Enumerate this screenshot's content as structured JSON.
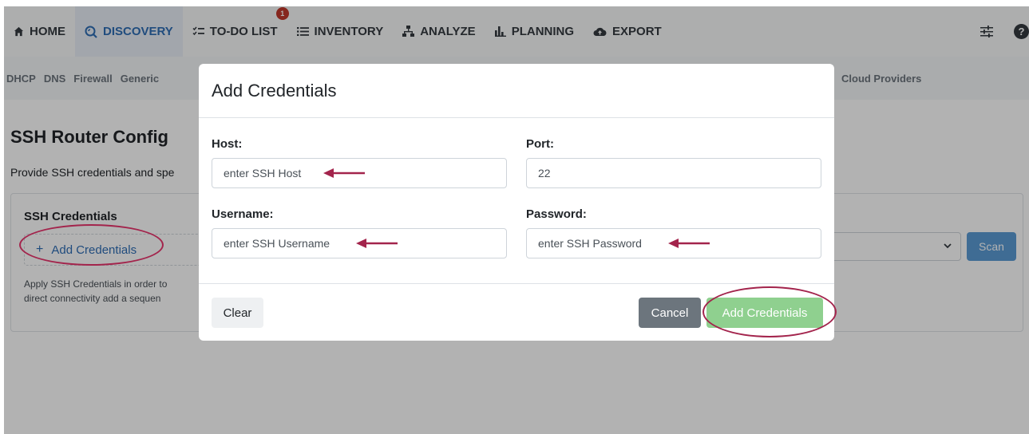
{
  "nav": {
    "items": [
      {
        "label": "HOME",
        "icon": "home-icon"
      },
      {
        "label": "DISCOVERY",
        "icon": "discovery-icon",
        "active": true
      },
      {
        "label": "TO-DO LIST",
        "icon": "checklist-icon",
        "badge": "1"
      },
      {
        "label": "INVENTORY",
        "icon": "list-icon"
      },
      {
        "label": "ANALYZE",
        "icon": "network-icon"
      },
      {
        "label": "PLANNING",
        "icon": "bar-chart-icon"
      },
      {
        "label": "EXPORT",
        "icon": "cloud-upload-icon"
      }
    ],
    "right_icons": [
      "sliders-icon",
      "help-icon"
    ]
  },
  "subnav": {
    "items": [
      "DHCP",
      "DNS",
      "Firewall",
      "Generic"
    ],
    "right_item": "Cloud Providers"
  },
  "page": {
    "title": "SSH Router Config",
    "subtitle": "Provide SSH credentials and spe"
  },
  "card": {
    "title": "SSH Credentials",
    "add_label": "Add Credentials",
    "help_line1": "Apply SSH Credentials in order to",
    "help_line2": "direct connectivity add a sequen",
    "scan_label": "Scan"
  },
  "modal": {
    "title": "Add Credentials",
    "host": {
      "label": "Host:",
      "placeholder": "enter SSH Host"
    },
    "port": {
      "label": "Port:",
      "value": "22"
    },
    "username": {
      "label": "Username:",
      "placeholder": "enter SSH Username"
    },
    "password": {
      "label": "Password:",
      "placeholder": "enter SSH Password"
    },
    "clear_label": "Clear",
    "cancel_label": "Cancel",
    "submit_label": "Add Credentials"
  },
  "colors": {
    "accent": "#2f6eb5",
    "annotation": "#a3244c",
    "submit": "#8fd08f",
    "cancel": "#6c757d",
    "badge": "#c0392b"
  }
}
